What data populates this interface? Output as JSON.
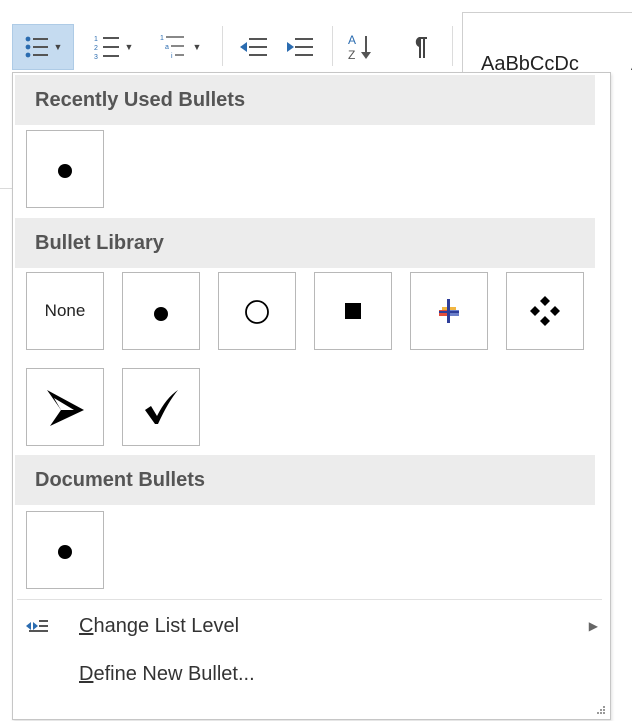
{
  "ribbon": {
    "styles_preview": "AaBbCcDc",
    "styles_next_initial": "A"
  },
  "bullets_menu": {
    "sections": {
      "recent": "Recently Used Bullets",
      "library": "Bullet Library",
      "document": "Document Bullets"
    },
    "library_none_label": "None",
    "change_list_level": {
      "prefix": "",
      "mnemonic": "C",
      "rest": "hange List Level"
    },
    "define_new_bullet": {
      "mnemonic": "D",
      "rest": "efine New Bullet..."
    }
  },
  "colors": {
    "active_button": "#c5dbf0",
    "section_header_bg": "#ececec",
    "icon_blue": "#2b6cb0"
  },
  "icons": {
    "toolbar": [
      "bullets-icon",
      "numbering-icon",
      "multilevel-list-icon",
      "decrease-indent-icon",
      "increase-indent-icon",
      "sort-icon",
      "show-formatting-marks-icon"
    ],
    "library": [
      "none",
      "filled-circle-bullet-icon",
      "hollow-circle-bullet-icon",
      "square-bullet-icon",
      "colored-cross-bullet-icon",
      "diamond-cluster-bullet-icon",
      "arrowhead-bullet-icon",
      "checkmark-bullet-icon"
    ]
  }
}
